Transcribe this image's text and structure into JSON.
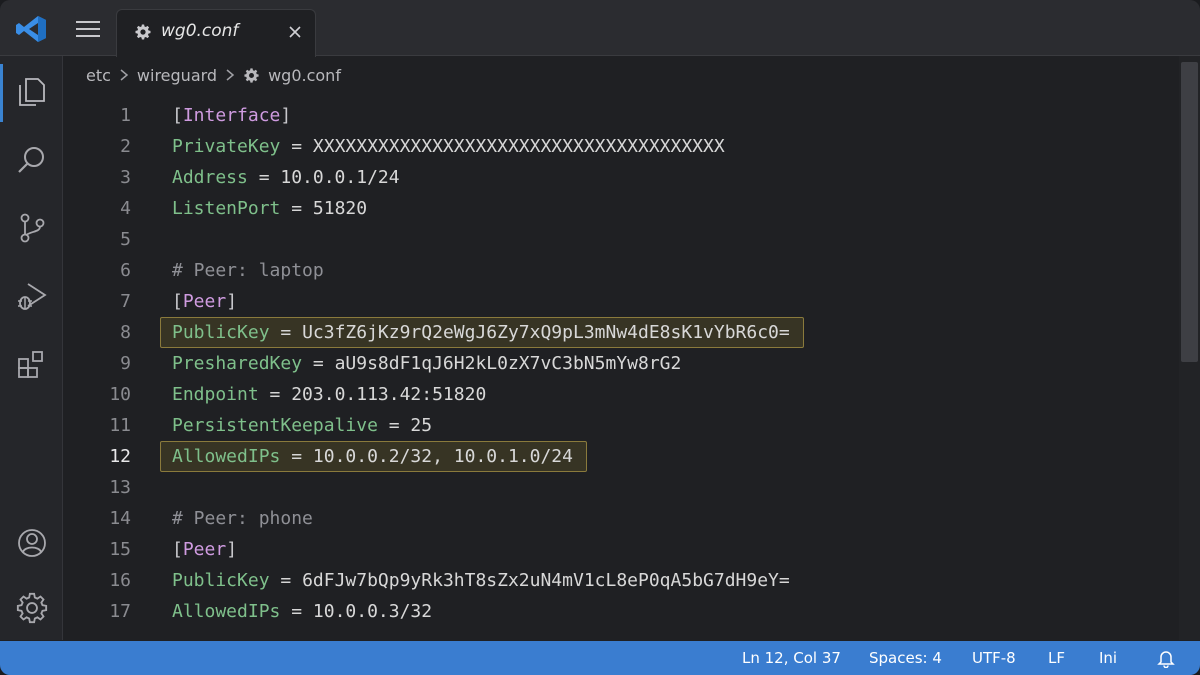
{
  "tab": {
    "title": "wg0.conf"
  },
  "breadcrumb": [
    "etc",
    "wireguard",
    "wg0.conf"
  ],
  "editor": {
    "active_line": 12,
    "highlighted_lines": [
      8,
      12
    ],
    "lines": [
      {
        "n": "1",
        "tokens": [
          {
            "t": "[",
            "c": "br"
          },
          {
            "t": "Interface",
            "c": "sec"
          },
          {
            "t": "]",
            "c": "br"
          }
        ]
      },
      {
        "n": "2",
        "tokens": [
          {
            "t": "PrivateKey",
            "c": "key"
          },
          {
            "t": " = ",
            "c": "op"
          },
          {
            "t": "XXXXXXXXXXXXXXXXXXXXXXXXXXXXXXXXXXXXXX",
            "c": "val"
          }
        ]
      },
      {
        "n": "3",
        "tokens": [
          {
            "t": "Address",
            "c": "key"
          },
          {
            "t": " = ",
            "c": "op"
          },
          {
            "t": "10.0.0.1/24",
            "c": "val"
          }
        ]
      },
      {
        "n": "4",
        "tokens": [
          {
            "t": "ListenPort",
            "c": "key"
          },
          {
            "t": " = ",
            "c": "op"
          },
          {
            "t": "51820",
            "c": "val"
          }
        ]
      },
      {
        "n": "5",
        "tokens": []
      },
      {
        "n": "6",
        "tokens": [
          {
            "t": "# Peer: laptop",
            "c": "com"
          }
        ]
      },
      {
        "n": "7",
        "tokens": [
          {
            "t": "[",
            "c": "br"
          },
          {
            "t": "Peer",
            "c": "sec"
          },
          {
            "t": "]",
            "c": "br"
          }
        ]
      },
      {
        "n": "8",
        "tokens": [
          {
            "t": "PublicKey",
            "c": "key"
          },
          {
            "t": " = ",
            "c": "op"
          },
          {
            "t": "Uc3fZ6jKz9rQ2eWgJ6Zy7xQ9pL3mNw4dE8sK1vYbR6c0=",
            "c": "val"
          }
        ]
      },
      {
        "n": "9",
        "tokens": [
          {
            "t": "PresharedKey",
            "c": "key"
          },
          {
            "t": " = ",
            "c": "op"
          },
          {
            "t": "aU9s8dF1qJ6H2kL0zX7vC3bN5mYw8rG2",
            "c": "val"
          }
        ]
      },
      {
        "n": "10",
        "tokens": [
          {
            "t": "Endpoint",
            "c": "key"
          },
          {
            "t": " = ",
            "c": "op"
          },
          {
            "t": "203.0.113.42:51820",
            "c": "val"
          }
        ]
      },
      {
        "n": "11",
        "tokens": [
          {
            "t": "PersistentKeepalive",
            "c": "key"
          },
          {
            "t": " = ",
            "c": "op"
          },
          {
            "t": "25",
            "c": "val"
          }
        ]
      },
      {
        "n": "12",
        "tokens": [
          {
            "t": "AllowedIPs",
            "c": "key"
          },
          {
            "t": " = ",
            "c": "op"
          },
          {
            "t": "10.0.0.2/32, 10.0.1.0/24",
            "c": "val"
          }
        ]
      },
      {
        "n": "13",
        "tokens": []
      },
      {
        "n": "14",
        "tokens": [
          {
            "t": "# Peer: phone",
            "c": "com"
          }
        ]
      },
      {
        "n": "15",
        "tokens": [
          {
            "t": "[",
            "c": "br"
          },
          {
            "t": "Peer",
            "c": "sec"
          },
          {
            "t": "]",
            "c": "br"
          }
        ]
      },
      {
        "n": "16",
        "tokens": [
          {
            "t": "PublicKey",
            "c": "key"
          },
          {
            "t": " = ",
            "c": "op"
          },
          {
            "t": "6dFJw7bQp9yRk3hT8sZx2uN4mV1cL8eP0qA5bG7dH9eY=",
            "c": "val"
          }
        ]
      },
      {
        "n": "17",
        "tokens": [
          {
            "t": "AllowedIPs",
            "c": "key"
          },
          {
            "t": " = ",
            "c": "op"
          },
          {
            "t": "10.0.0.3/32",
            "c": "val"
          }
        ]
      }
    ]
  },
  "activity_bar": [
    {
      "name": "explorer-icon",
      "active": true
    },
    {
      "name": "search-icon",
      "active": false
    },
    {
      "name": "source-control-icon",
      "active": false
    },
    {
      "name": "run-debug-icon",
      "active": false
    },
    {
      "name": "extensions-icon",
      "active": false
    },
    {
      "name": "account-icon",
      "active": false
    },
    {
      "name": "settings-gear-icon",
      "active": false
    }
  ],
  "status_bar": {
    "cursor": "Ln 12, Col 37",
    "indent": "Spaces: 4",
    "encoding": "UTF-8",
    "eol": "LF",
    "language": "Ini",
    "bell_icon": "bell-icon"
  },
  "colors": {
    "status_bar": "#3a7dd0",
    "accent": "#3a83d1",
    "key": "#7fc08b",
    "section": "#cf9be0",
    "comment": "#8f9096",
    "highlight_border": "#8a7a3c"
  }
}
